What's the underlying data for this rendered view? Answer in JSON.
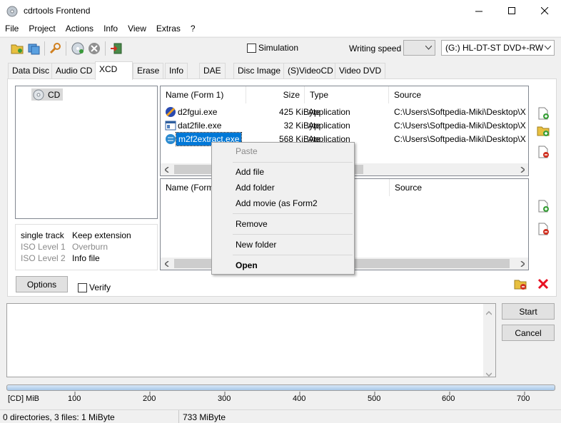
{
  "window": {
    "title": "cdrtools Frontend"
  },
  "menu": [
    "File",
    "Project",
    "Actions",
    "Info",
    "View",
    "Extras",
    "?"
  ],
  "toolbar": {
    "simulation_label": "Simulation",
    "writing_speed_label": "Writing speed",
    "writing_speed_value": "",
    "drive_value": "(G:) HL-DT-ST DVD+-RW"
  },
  "tabs": [
    "Data Disc",
    "Audio CD",
    "XCD",
    "Erase",
    "Info",
    "DAE",
    "Disc Image",
    "(S)VideoCD",
    "Video DVD"
  ],
  "active_tab": "XCD",
  "tree": {
    "root_label": "CD"
  },
  "options_info": {
    "col1": [
      "single track",
      "ISO Level 1",
      "ISO Level 2"
    ],
    "col2": [
      "Keep extension",
      "Overburn",
      "Info file"
    ]
  },
  "form1": {
    "columns": [
      "Name (Form 1)",
      "Size",
      "Type",
      "Source"
    ],
    "rows": [
      {
        "name": "d2fgui.exe",
        "size": "425 KiByte",
        "type": "Application",
        "source": "C:\\Users\\Softpedia-Miki\\Desktop\\X"
      },
      {
        "name": "dat2file.exe",
        "size": "32 KiByte",
        "type": "Application",
        "source": "C:\\Users\\Softpedia-Miki\\Desktop\\X"
      },
      {
        "name": "m2f2extract.exe",
        "size": "568 KiByte",
        "type": "Application",
        "source": "C:\\Users\\Softpedia-Miki\\Desktop\\X"
      }
    ]
  },
  "form2": {
    "columns": [
      "Name (Form",
      "Source"
    ]
  },
  "buttons": {
    "options": "Options",
    "verify": "Verify",
    "start": "Start",
    "cancel": "Cancel"
  },
  "context_menu": {
    "paste": "Paste",
    "add_file": "Add file",
    "add_folder": "Add folder",
    "add_movie": "Add movie (as Form2",
    "remove": "Remove",
    "new_folder": "New folder",
    "open": "Open"
  },
  "capacity": {
    "unit_label": "[CD] MiB",
    "ticks": [
      "100",
      "200",
      "300",
      "400",
      "500",
      "600",
      "700"
    ]
  },
  "status": {
    "files": "0 directories, 3 files: 1 MiByte",
    "capacity": "733 MiByte"
  },
  "colors": {
    "selection": "#0078d7",
    "accent": "#0078d7",
    "red_x": "#e81123"
  }
}
